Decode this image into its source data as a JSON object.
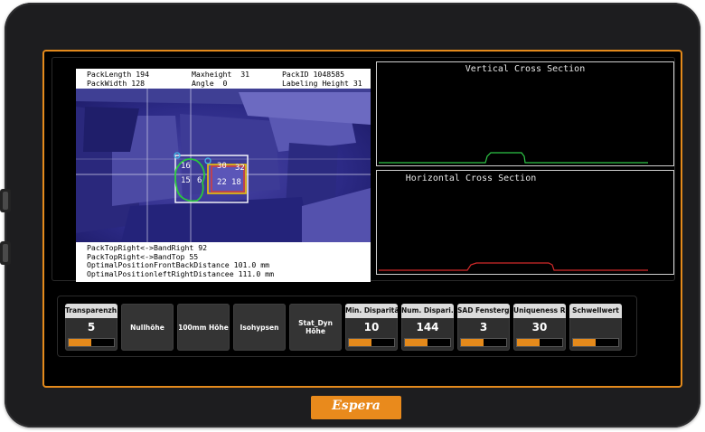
{
  "camera": {
    "info_top": [
      {
        "label": "PackLength 194",
        "label2": "Maxheight  31",
        "label3": "PackID 1048585"
      },
      {
        "label": "PackWidth 128",
        "label2": "Angle  0",
        "label3": "Labeling Height 31"
      }
    ],
    "info_bottom": [
      "PackTopRight<->BandRight 92",
      "PackTopRight<->BandTop 55",
      "OptimalPositionFrontBackDistance 101.0 mm",
      "OptimalPositionleftRightDistancee 111.0 mm"
    ],
    "region_labels": [
      "16",
      "30",
      "15",
      "6",
      "22",
      "18",
      "32"
    ]
  },
  "vertical_section": {
    "title": "Vertical Cross Section",
    "line_color": "#2ec646"
  },
  "horizontal_section": {
    "title": "Horizontal Cross Section",
    "line_color": "#d42a2a"
  },
  "controls": [
    {
      "label": "Transparenzh...",
      "value": "5",
      "fill": 0.5
    },
    {
      "label": "Nullhöhe"
    },
    {
      "label": "100mm Höhe"
    },
    {
      "label": "Isohypsen"
    },
    {
      "label": "Stat_Dyn Höhe"
    },
    {
      "label": "Min. Disparität",
      "value": "10",
      "fill": 0.5
    },
    {
      "label": "Num. Dispari...",
      "value": "144",
      "fill": 0.5
    },
    {
      "label": "SAD Fensterg...",
      "value": "3",
      "fill": 0.5
    },
    {
      "label": "Uniqueness R...",
      "value": "30",
      "fill": 0.5
    },
    {
      "label": "Schwellwert",
      "value": "",
      "fill": 0.5
    }
  ],
  "brand": {
    "name": "Espera",
    "color": "#e98a1c"
  }
}
